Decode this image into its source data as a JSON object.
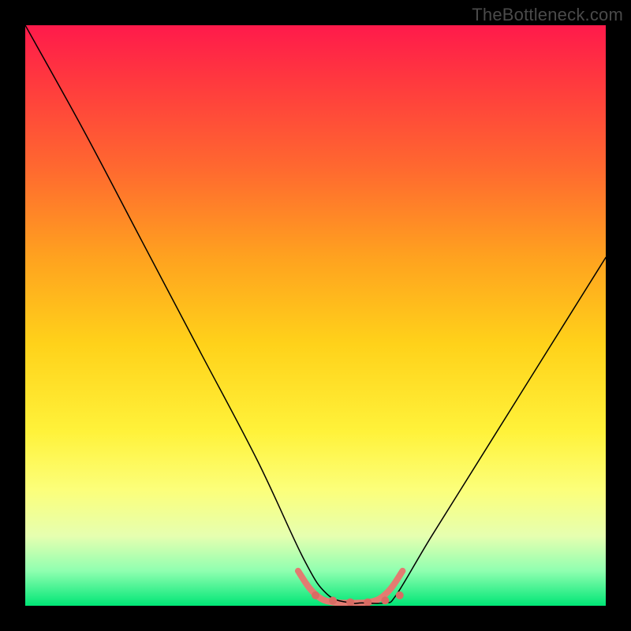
{
  "watermark": "TheBottleneck.com",
  "chart_data": {
    "type": "line",
    "title": "",
    "xlabel": "",
    "ylabel": "",
    "xlim": [
      0,
      100
    ],
    "ylim": [
      0,
      100
    ],
    "series": [
      {
        "name": "bottleneck-curve",
        "x": [
          0,
          10,
          20,
          30,
          40,
          48,
          52,
          56,
          58,
          62,
          64,
          70,
          80,
          90,
          100
        ],
        "values": [
          100,
          82,
          63,
          44,
          25,
          8,
          2,
          0.5,
          0.5,
          0.5,
          2,
          12,
          28,
          44,
          60
        ],
        "stroke": "#000000",
        "width": 1.5
      }
    ],
    "annotations": [
      {
        "name": "flat-bottom-highlight",
        "x": [
          47,
          49,
          51,
          53,
          55,
          57,
          59,
          61,
          63,
          65
        ],
        "values": [
          6,
          3,
          1.2,
          0.6,
          0.5,
          0.5,
          0.6,
          1.2,
          3,
          6
        ],
        "stroke": "#e37b71",
        "width": 8
      },
      {
        "name": "flat-bottom-dots",
        "points": [
          {
            "x": 50,
            "y": 1.8
          },
          {
            "x": 53,
            "y": 0.9
          },
          {
            "x": 56,
            "y": 0.6
          },
          {
            "x": 59,
            "y": 0.6
          },
          {
            "x": 62,
            "y": 0.9
          },
          {
            "x": 64.5,
            "y": 1.8
          }
        ],
        "fill": "#d96b63",
        "radius": 5
      }
    ]
  }
}
